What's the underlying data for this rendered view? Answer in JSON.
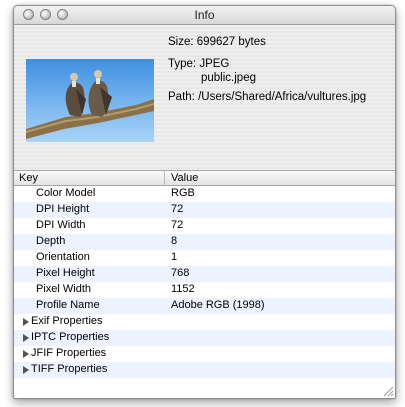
{
  "window": {
    "title": "Info"
  },
  "file": {
    "size_label": "Size:",
    "size_value": "699627 bytes",
    "type_label": "Type:",
    "type_value": "JPEG",
    "type_uti": "public.jpeg",
    "path_label": "Path:",
    "path_value": "/Users/Shared/Africa/vultures.jpg"
  },
  "table": {
    "columns": {
      "key": "Key",
      "value": "Value"
    },
    "rows": [
      {
        "key": "Color Model",
        "value": "RGB"
      },
      {
        "key": "DPI Height",
        "value": "72"
      },
      {
        "key": "DPI Width",
        "value": "72"
      },
      {
        "key": "Depth",
        "value": "8"
      },
      {
        "key": "Orientation",
        "value": "1"
      },
      {
        "key": "Pixel Height",
        "value": "768"
      },
      {
        "key": "Pixel Width",
        "value": "1152"
      },
      {
        "key": "Profile Name",
        "value": "Adobe RGB (1998)"
      }
    ],
    "groups": [
      {
        "label": "Exif Properties"
      },
      {
        "label": "IPTC Properties"
      },
      {
        "label": "JFIF Properties"
      },
      {
        "label": "TIFF Properties"
      }
    ]
  }
}
